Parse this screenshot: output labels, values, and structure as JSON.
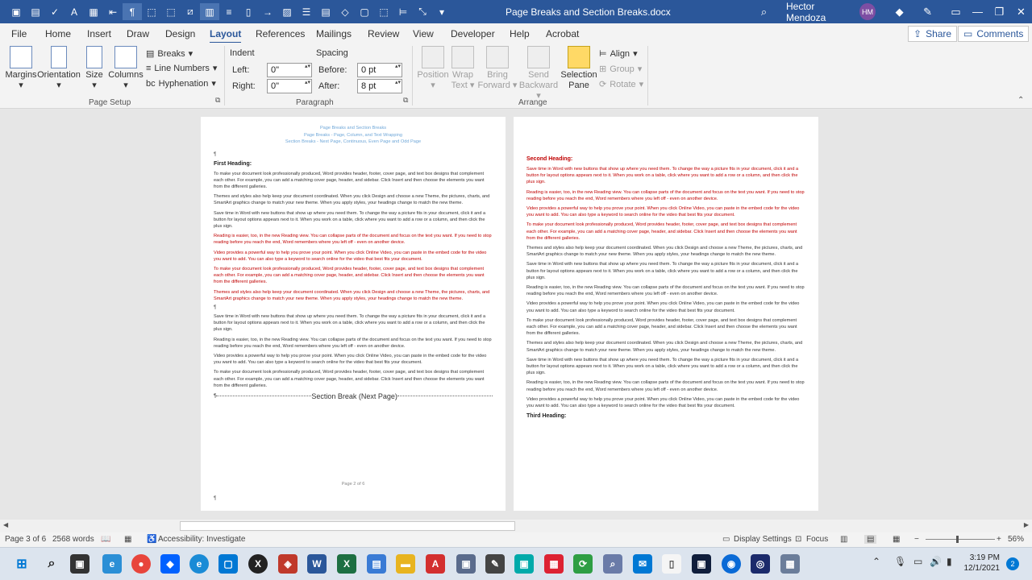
{
  "window": {
    "title": "Page Breaks and Section Breaks.docx",
    "user": "Hector Mendoza",
    "initials": "HM"
  },
  "menu": {
    "tabs": [
      "File",
      "Home",
      "Insert",
      "Draw",
      "Design",
      "Layout",
      "References",
      "Mailings",
      "Review",
      "View",
      "Developer",
      "Help",
      "Acrobat"
    ],
    "active": "Layout",
    "share": "Share",
    "comments": "Comments"
  },
  "ribbon": {
    "page_setup": {
      "margins": "Margins",
      "orientation": "Orientation",
      "size": "Size",
      "columns": "Columns",
      "breaks": "Breaks",
      "line_numbers": "Line Numbers",
      "hyphenation": "Hyphenation",
      "group": "Page Setup"
    },
    "paragraph": {
      "indent": "Indent",
      "spacing": "Spacing",
      "left_label": "Left:",
      "left_value": "0\"",
      "right_label": "Right:",
      "right_value": "0\"",
      "before_label": "Before:",
      "before_value": "0 pt",
      "after_label": "After:",
      "after_value": "8 pt",
      "group": "Paragraph"
    },
    "arrange": {
      "position": "Position",
      "wrap_text_1": "Wrap",
      "wrap_text_2": "Text",
      "bring_forward_1": "Bring",
      "bring_forward_2": "Forward",
      "send_backward_1": "Send",
      "send_backward_2": "Backward",
      "selection_pane_1": "Selection",
      "selection_pane_2": "Pane",
      "align": "Align",
      "group_btn": "Group",
      "rotate": "Rotate",
      "group": "Arrange"
    }
  },
  "left_page": {
    "header": [
      "Page Breaks and Section Breaks",
      "Page Breaks - Page, Column, and Text Wrapping",
      "Section Breaks - Next Page, Continuous, Even Page and Odd Page"
    ],
    "heading": "First Heading:",
    "paras": [
      {
        "t": "To make your document look professionally produced, Word provides header, footer, cover page, and text box designs that complement each other. For example, you can add a matching cover page, header, and sidebar. Click Insert and then choose the elements you want from the different galleries.",
        "red": false
      },
      {
        "t": "Themes and styles also help keep your document coordinated. When you click Design and choose a new Theme, the pictures, charts, and SmartArt graphics change to match your new theme. When you apply styles, your headings change to match the new theme.",
        "red": false
      },
      {
        "t": "Save time in Word with new buttons that show up where you need them. To change the way a picture fits in your document, click it and a button for layout options appears next to it. When you work on a table, click where you want to add a row or a column, and then click the plus sign.",
        "red": false
      },
      {
        "t": "Reading is easier, too, in the new Reading view. You can collapse parts of the document and focus on the text you want. If you need to stop reading before you reach the end, Word remembers where you left off - even on another device.",
        "red": true
      },
      {
        "t": "Video provides a powerful way to help you prove your point. When you click Online Video, you can paste in the embed code for the video you want to add. You can also type a keyword to search online for the video that best fits your document.",
        "red": true
      },
      {
        "t": "To make your document look professionally produced, Word provides header, footer, cover page, and text box designs that complement each other. For example, you can add a matching cover page, header, and sidebar. Click Insert and then choose the elements you want from the different galleries.",
        "red": true
      },
      {
        "t": "Themes and styles also help keep your document coordinated. When you click Design and choose a new Theme, the pictures, charts, and SmartArt graphics change to match your new theme. When you apply styles, your headings change to match the new theme.",
        "red": true
      }
    ],
    "paras2": [
      "Save time in Word with new buttons that show up where you need them. To change the way a picture fits in your document, click it and a button for layout options appears next to it. When you work on a table, click where you want to add a row or a column, and then click the plus sign.",
      "Reading is easier, too, in the new Reading view. You can collapse parts of the document and focus on the text you want. If you need to stop reading before you reach the end, Word remembers where you left off - even on another device.",
      "Video provides a powerful way to help you prove your point. When you click Online Video, you can paste in the embed code for the video you want to add. You can also type a keyword to search online for the video that best fits your document.",
      "To make your document look professionally produced, Word provides header, footer, cover page, and text box designs that complement each other. For example, you can add a matching cover page, header, and sidebar. Click Insert and then choose the elements you want from the different galleries."
    ],
    "section_break": "Section Break (Next Page)",
    "footer": "Page 2 of 6"
  },
  "right_page": {
    "heading": "Second Heading:",
    "red_paras": [
      "Save time in Word with new buttons that show up where you need them. To change the way a picture fits in your document, click it and a button for layout options appears next to it. When you work on a table, click where you want to add a row or a column, and then click the plus sign.",
      "Reading is easier, too, in the new Reading view. You can collapse parts of the document and focus on the text you want. If you need to stop reading before you reach the end, Word remembers where you left off - even on another device.",
      "Video provides a powerful way to help you prove your point. When you click Online Video, you can paste in the embed code for the video you want to add. You can also type a keyword to search online for the video that best fits your document.",
      "To make your document look professionally produced, Word provides header, footer, cover page, and text box designs that complement each other. For example, you can add a matching cover page, header, and sidebar. Click Insert and then choose the elements you want from the different galleries."
    ],
    "paras": [
      "Themes and styles also help keep your document coordinated. When you click Design and choose a new Theme, the pictures, charts, and SmartArt graphics change to match your new theme. When you apply styles, your headings change to match the new theme.",
      "Save time in Word with new buttons that show up where you need them. To change the way a picture fits in your document, click it and a button for layout options appears next to it. When you work on a table, click where you want to add a row or a column, and then click the plus sign.",
      "Reading is easier, too, in the new Reading view. You can collapse parts of the document and focus on the text you want. If you need to stop reading before you reach the end, Word remembers where you left off - even on another device.",
      "Video provides a powerful way to help you prove your point. When you click Online Video, you can paste in the embed code for the video you want to add. You can also type a keyword to search online for the video that best fits your document.",
      "To make your document look professionally produced, Word provides header, footer, cover page, and text box designs that complement each other. For example, you can add a matching cover page, header, and sidebar. Click Insert and then choose the elements you want from the different galleries.",
      "Themes and styles also help keep your document coordinated. When you click Design and choose a new Theme, the pictures, charts, and SmartArt graphics change to match your new theme. When you apply styles, your headings change to match the new theme.",
      "Save time in Word with new buttons that show up where you need them. To change the way a picture fits in your document, click it and a button for layout options appears next to it. When you work on a table, click where you want to add a row or a column, and then click the plus sign.",
      "Reading is easier, too, in the new Reading view. You can collapse parts of the document and focus on the text you want. If you need to stop reading before you reach the end, Word remembers where you left off - even on another device.",
      "Video provides a powerful way to help you prove your point. When you click Online Video, you can paste in the embed code for the video you want to add. You can also type a keyword to search online for the video that best fits your document."
    ],
    "heading3": "Third Heading:"
  },
  "status": {
    "page": "Page 3 of 6",
    "words": "2568 words",
    "accessibility": "Accessibility: Investigate",
    "display_settings": "Display Settings",
    "focus": "Focus",
    "zoom": "56%"
  },
  "clock": {
    "time": "3:19 PM",
    "date": "12/1/2021",
    "badge": "2"
  },
  "colors": {
    "accent": "#2b579a",
    "red_text": "#c00000",
    "header_text": "#6fa7d8"
  }
}
